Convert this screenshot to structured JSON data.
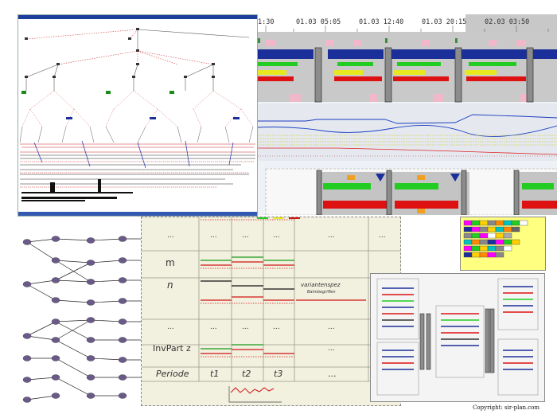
{
  "timeline": {
    "labels": [
      "1:30",
      "01.03 05:05",
      "01.03 12:40",
      "01.03 20:15",
      "02.03 03:50"
    ]
  },
  "table": {
    "header_cells": [
      "...",
      "...",
      "...",
      "...",
      "..."
    ],
    "row_labels": [
      "m",
      "n",
      "InvPart z"
    ],
    "periode_label": "Periode",
    "periods": [
      "t1",
      "t2",
      "t3",
      "..."
    ],
    "variant_note_main": "variantenspez",
    "variant_note_sub": "Bahnbegriffen",
    "ellipsis": "..."
  },
  "copyright": "Copyright: sir-plan.com"
}
